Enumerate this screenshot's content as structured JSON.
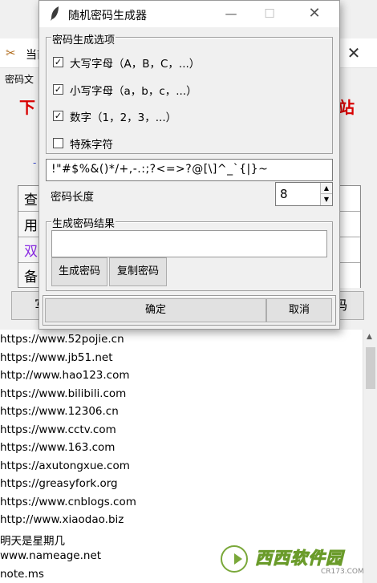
{
  "main": {
    "title": "当前",
    "label": "密码文",
    "side_left": "下",
    "side_right": "站",
    "dash": "-",
    "rows": [
      "查",
      "用",
      "双",
      "备"
    ],
    "row_colors": [
      "#000000",
      "#000000",
      "#8a2be2",
      "#000000"
    ],
    "button_left": "写",
    "button_right": "码",
    "list": [
      "https://www.52pojie.cn",
      "https://www.jb51.net",
      "http://www.hao123.com",
      "https://www.bilibili.com",
      "https://www.12306.cn",
      "https://www.cctv.com",
      "https://www.163.com",
      "https://axutongxue.com",
      "https://greasyfork.org",
      "https://www.cnblogs.com",
      "http://www.xiaodao.biz",
      "明天是星期几",
      "www.nameage.net",
      "note.ms"
    ]
  },
  "dialog": {
    "title": "随机密码生成器",
    "options_group_title": "密码生成选项",
    "options": [
      {
        "label": "大写字母（A，B，C，...）",
        "checked": true
      },
      {
        "label": "小写字母（a，b，c，...）",
        "checked": true
      },
      {
        "label": "数字（1，2，3，...）",
        "checked": true
      },
      {
        "label": "特殊字符",
        "checked": false
      }
    ],
    "special_chars": "!\"#$%&()*/+,-.:;?<=>?@[\\]^_`{|}~",
    "length_label": "密码长度",
    "length_value": "8",
    "result_group_title": "生成密码结果",
    "result_value": "",
    "generate_button": "生成密码",
    "copy_button": "复制密码",
    "ok_button": "确定",
    "cancel_button": "取消"
  },
  "watermark": {
    "text": "西西软件园",
    "url": "CR173.COM"
  }
}
